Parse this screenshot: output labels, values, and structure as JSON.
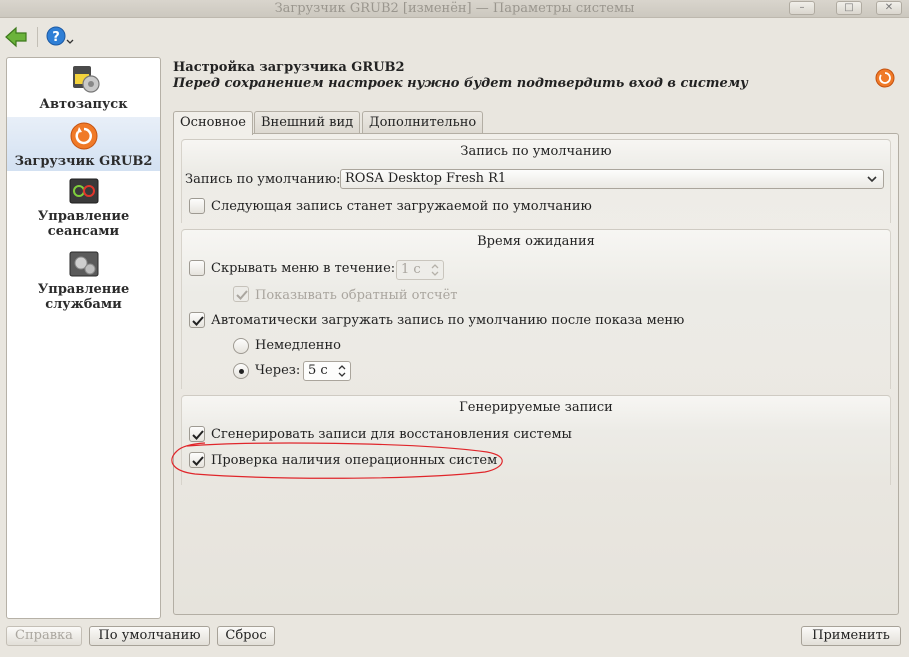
{
  "window": {
    "title": "Загрузчик GRUB2 [изменён] — Параметры системы",
    "buttons": {
      "minimize": "–",
      "maximize": "□",
      "close": "✕"
    }
  },
  "toolbar": {
    "back_icon": "back-arrow-icon",
    "help_icon": "help-icon"
  },
  "sidebar": {
    "items": [
      {
        "label": "Автозапуск",
        "icon": "autostart-icon",
        "selected": false
      },
      {
        "label": "Загрузчик GRUB2",
        "icon": "grub2-icon",
        "selected": true
      },
      {
        "label_line1": "Управление",
        "label_line2": "сеансами",
        "icon": "session-icon",
        "selected": false
      },
      {
        "label_line1": "Управление",
        "label_line2": "службами",
        "icon": "services-icon",
        "selected": false
      }
    ]
  },
  "header": {
    "title": "Настройка загрузчика GRUB2",
    "subtitle": "Перед сохранением настроек нужно будет подтвердить вход в систему"
  },
  "tabs": [
    {
      "label": "Основное",
      "active": true
    },
    {
      "label": "Внешний вид",
      "active": false
    },
    {
      "label": "Дополнительно",
      "active": false
    }
  ],
  "default_entry": {
    "group_title": "Запись по умолчанию",
    "label": "Запись по умолчанию:",
    "value": "ROSA Desktop Fresh R1",
    "next_entry_label": "Следующая запись станет загружаемой по умолчанию",
    "next_entry_checked": false
  },
  "timeout": {
    "group_title": "Время ожидания",
    "hide_menu_label": "Скрывать меню в течение:",
    "hide_menu_checked": false,
    "hide_menu_value": "1 с",
    "countdown_label": "Показывать обратный отсчёт",
    "countdown_checked": true,
    "auto_boot_label": "Автоматически загружать запись по умолчанию после показа меню",
    "auto_boot_checked": true,
    "immediately_label": "Немедленно",
    "after_label": "Через:",
    "after_value": "5 с"
  },
  "generated": {
    "group_title": "Генерируемые записи",
    "recovery_label": "Сгенерировать записи для восстановления системы",
    "recovery_checked": true,
    "os_probe_label": "Проверка наличия операционных систем",
    "os_probe_checked": true
  },
  "buttons": {
    "help": "Справка",
    "defaults": "По умолчанию",
    "reset": "Сброс",
    "apply": "Применить"
  },
  "colors": {
    "annotation": "#e0262b",
    "grub_icon": "#f07a28",
    "help_icon": "#2f7fd6",
    "back_icon": "#6bb33b"
  }
}
